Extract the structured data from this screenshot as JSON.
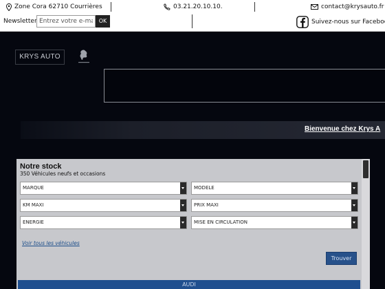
{
  "topbar": {
    "address": "Zone Cora 62710 Courrières",
    "phone": "03.21.20.10.10.",
    "email": "contact@krysauto.fr",
    "newsletter_label": "Newsletter",
    "newsletter_placeholder": "Entrez votre e-mail",
    "newsletter_button": "OK",
    "facebook_label": "Suivez-nous sur Facebook",
    "icons": [
      "map-pin-icon",
      "phone-icon",
      "envelope-icon",
      "facebook-icon"
    ]
  },
  "header": {
    "logo_text": "KRYS AUTO",
    "brand_logo": "peugeot-lion-logo",
    "welcome_text": "Bienvenue chez Krys A"
  },
  "stock": {
    "title": "Notre stock",
    "subtitle": "350 Véhicules neufs et occasions",
    "filters": {
      "marque": "MARQUE",
      "modele": "MODELE",
      "km_maxi": "KM MAXI",
      "prix_maxi": "PRIX MAXI",
      "energie": "ENERGIE",
      "mise_en_circulation": "MISE EN CIRCULATION"
    },
    "view_all_link": "Voir tous les véhicules",
    "search_button": "Trouver",
    "brand_bar": "AUDI"
  },
  "colors": {
    "page_background": "#05070f",
    "topbar_background": "#ffffff",
    "panel_background": "#c7c8cc",
    "accent_blue": "#27518a",
    "brand_bar_blue": "#1f4f8f"
  }
}
